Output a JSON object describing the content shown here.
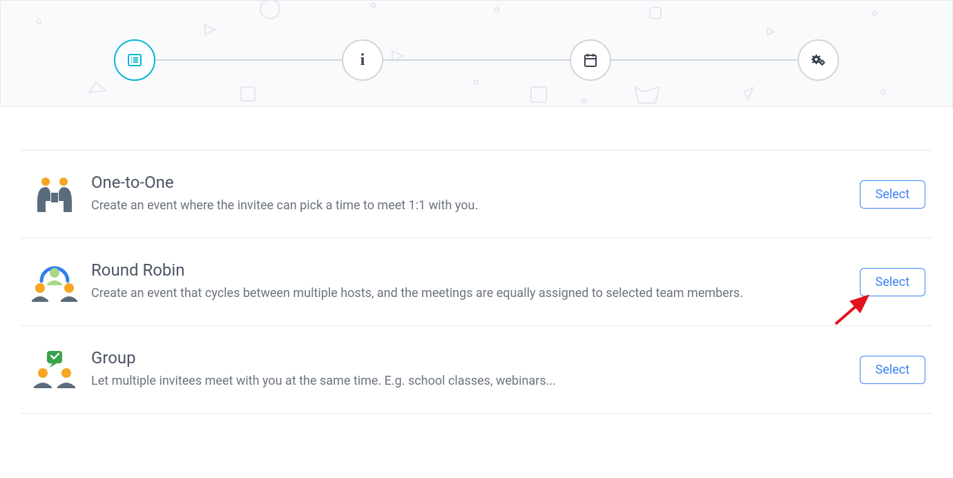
{
  "stepper": {
    "steps": [
      "type",
      "info",
      "schedule",
      "settings"
    ]
  },
  "options": [
    {
      "title": "One-to-One",
      "description": "Create an event where the invitee can pick a time to meet 1:1 with you.",
      "select_label": "Select",
      "icon": "one-to-one"
    },
    {
      "title": "Round Robin",
      "description": "Create an event that cycles between multiple hosts, and the meetings are equally assigned to selected team members.",
      "select_label": "Select",
      "icon": "round-robin"
    },
    {
      "title": "Group",
      "description": "Let multiple invitees meet with you at the same time. E.g. school classes, webinars...",
      "select_label": "Select",
      "icon": "group"
    }
  ],
  "annotation": {
    "points_to": "round-robin-select"
  }
}
